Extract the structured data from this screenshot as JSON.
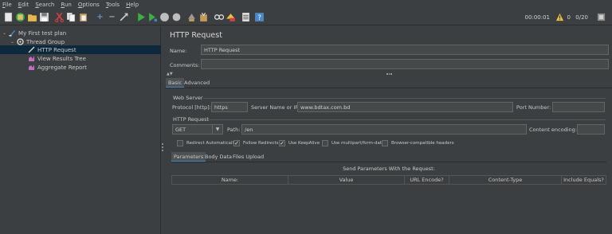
{
  "menu": {
    "items": [
      {
        "label": "File",
        "accel": "F",
        "rest": "ile"
      },
      {
        "label": "Edit",
        "accel": "E",
        "rest": "dit"
      },
      {
        "label": "Search",
        "accel": "S",
        "rest": "earch"
      },
      {
        "label": "Run",
        "accel": "R",
        "rest": "un"
      },
      {
        "label": "Options",
        "accel": "O",
        "rest": "ptions"
      },
      {
        "label": "Tools",
        "accel": "T",
        "rest": "ools"
      },
      {
        "label": "Help",
        "accel": "H",
        "rest": "elp"
      }
    ]
  },
  "toolbar": {
    "timer": "00:00:01",
    "warnings": "0",
    "threads": "0/20",
    "icons": [
      "new-icon",
      "templates-icon",
      "open-icon",
      "save-icon",
      "cut-icon",
      "copy-icon",
      "paste-icon",
      "expand-icon",
      "collapse-icon",
      "toggle-icon",
      "start-icon",
      "start-no-pause-icon",
      "stop-icon",
      "shutdown-icon",
      "clear-icon",
      "clear-all-icon",
      "search-icon",
      "reset-search-icon",
      "function-helper-icon",
      "help-icon"
    ]
  },
  "tree": {
    "items": [
      {
        "label": "My First test plan",
        "icon": "test-plan-icon"
      },
      {
        "label": "Thread Group",
        "icon": "thread-group-icon"
      },
      {
        "label": "HTTP Request",
        "icon": "http-sampler-icon"
      },
      {
        "label": "View Results Tree",
        "icon": "listener-icon"
      },
      {
        "label": "Aggregate Report",
        "icon": "listener-icon"
      }
    ]
  },
  "panel": {
    "title": "HTTP Request",
    "name_label": "Name:",
    "name_value": "HTTP Request",
    "comments_label": "Comments:",
    "comments_value": "",
    "tabs": [
      "Basic",
      "Advanced"
    ],
    "web_server": {
      "section": "Web Server",
      "protocol_label": "Protocol [http]:",
      "protocol_value": "https",
      "server_label": "Server Name or IP:",
      "server_value": "www.bdtax.com.bd",
      "port_label": "Port Number:",
      "port_value": ""
    },
    "http_request": {
      "section": "HTTP Request",
      "method": "GET",
      "path_label": "Path:",
      "path_value": "/en",
      "encoding_label": "Content encoding:",
      "encoding_value": ""
    },
    "checkboxes": [
      {
        "label": "Redirect Automatically",
        "checked": false
      },
      {
        "label": "Follow Redirects",
        "checked": true
      },
      {
        "label": "Use KeepAlive",
        "checked": true
      },
      {
        "label": "Use multipart/form-data",
        "checked": false
      },
      {
        "label": "Browser-compatible headers",
        "checked": false
      }
    ],
    "subtabs": [
      "Parameters",
      "Body Data",
      "Files Upload"
    ],
    "params_title": "Send Parameters With the Request:",
    "columns": [
      "Name:",
      "Value",
      "URL Encode?",
      "Content-Type",
      "Include Equals?"
    ]
  }
}
